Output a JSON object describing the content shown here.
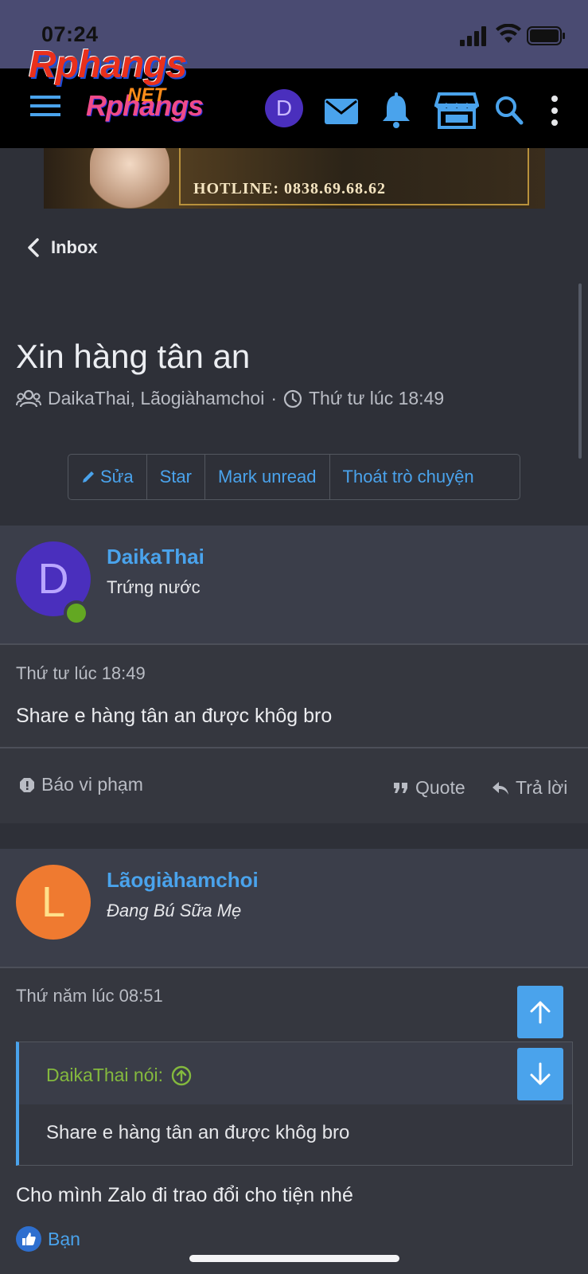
{
  "status": {
    "time": "07:24"
  },
  "header": {
    "logo_top": "Rphangs",
    "logo_net": "NET",
    "logo_bottom": "Rphangs",
    "avatar_letter": "D"
  },
  "banner": {
    "text": "HOTLINE: 0838.69.68.62"
  },
  "nav": {
    "back_label": "Inbox"
  },
  "conversation": {
    "title": "Xin hàng tân an",
    "participants": "DaikaThai, Lãogiàhamchoi",
    "separator": "·",
    "time": "Thứ tư lúc 18:49"
  },
  "actions": {
    "edit": "Sửa",
    "star": "Star",
    "mark_unread": "Mark unread",
    "leave": "Thoát trò chuyện"
  },
  "messages": [
    {
      "avatar_letter": "D",
      "avatar_color": "#4a2fbd",
      "username": "DaikaThai",
      "user_title": "Trứng nước",
      "timestamp": "Thứ tư lúc 18:49",
      "content": "Share e hàng tân an được khôg bro",
      "report": "Báo vi phạm",
      "quote": "Quote",
      "reply": "Trả lời"
    },
    {
      "avatar_letter": "L",
      "avatar_color": "#ef7a30",
      "username": "Lãogiàhamchoi",
      "user_title": "Đang Bú Sữa Mẹ",
      "timestamp": "Thứ năm lúc 08:51",
      "quote_header": "DaikaThai nói:",
      "quote_text": "Share e hàng tân an được khôg bro",
      "content": "Cho mình Zalo đi trao đổi cho tiện nhé",
      "reaction": "Bạn"
    }
  ],
  "colors": {
    "accent": "#4aa3ec",
    "online": "#63a822",
    "quote_author": "#84b93e"
  }
}
